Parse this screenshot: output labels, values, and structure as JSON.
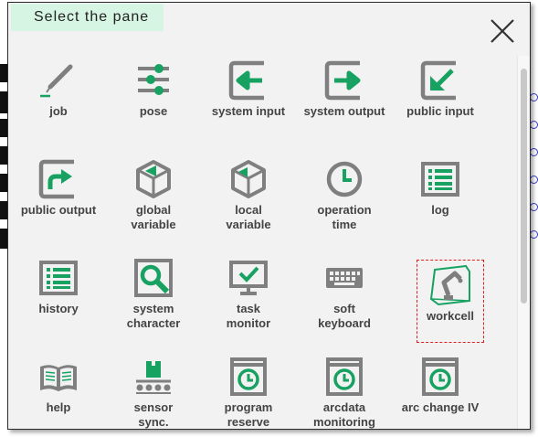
{
  "dialog": {
    "title": "Select the pane"
  },
  "colors": {
    "icon_gray": "#7f7f7f",
    "icon_green": "#17a262",
    "title_bg": "#d6f5e3",
    "selection_border": "#e02020"
  },
  "tiles": [
    {
      "icon": "pencil-icon",
      "label": "job"
    },
    {
      "icon": "sliders-icon",
      "label": "pose"
    },
    {
      "icon": "arrow-in-icon",
      "label": "system input"
    },
    {
      "icon": "arrow-out-icon",
      "label": "system output"
    },
    {
      "icon": "arrow-in-diagonal-icon",
      "label": "public input"
    },
    {
      "icon": "arrow-out-diagonal-icon",
      "label": "public output"
    },
    {
      "icon": "cube-global-icon",
      "label": "global variable"
    },
    {
      "icon": "cube-local-icon",
      "label": "local variable"
    },
    {
      "icon": "clock-icon",
      "label": "operation time"
    },
    {
      "icon": "list-icon",
      "label": "log"
    },
    {
      "icon": "list-icon",
      "label": "history"
    },
    {
      "icon": "magnifier-icon",
      "label": "system character"
    },
    {
      "icon": "monitor-check-icon",
      "label": "task monitor"
    },
    {
      "icon": "keyboard-icon",
      "label": "soft keyboard"
    },
    {
      "icon": "robot-arm-icon",
      "label": "workcell",
      "selected": true
    },
    {
      "icon": "book-icon",
      "label": "help"
    },
    {
      "icon": "conveyor-icon",
      "label": "sensor sync."
    },
    {
      "icon": "clock-panel-icon",
      "label": "program reserve"
    },
    {
      "icon": "clock-panel-icon",
      "label": "arcdata monitoring"
    },
    {
      "icon": "clock-panel-icon",
      "label": "arc change IV"
    }
  ]
}
